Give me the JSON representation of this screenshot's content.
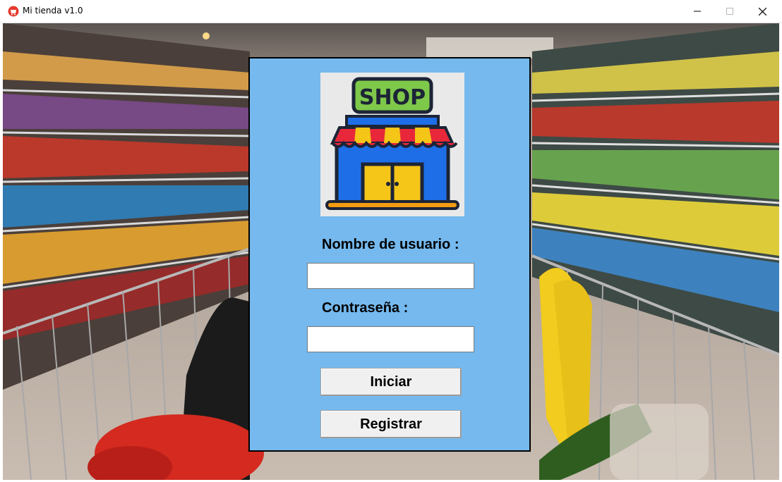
{
  "window": {
    "title": "Mi tienda v1.0",
    "controls": [
      "minimize",
      "maximize",
      "close"
    ]
  },
  "background": {
    "image": "supermarket-aisle-with-shopping-cart"
  },
  "logo": {
    "text": "SHOP",
    "icon": "shop-storefront-icon"
  },
  "login": {
    "username_label": "Nombre de usuario :",
    "username_value": "",
    "password_label": "Contraseña :",
    "password_value": "",
    "login_button": "Iniciar",
    "register_button": "Registrar"
  },
  "colors": {
    "panel": "#75b9ee",
    "shop_sign": "#7ec84a",
    "store_body": "#1e6ee8",
    "awning_red": "#e8283a",
    "awning_yellow": "#f5c518"
  }
}
